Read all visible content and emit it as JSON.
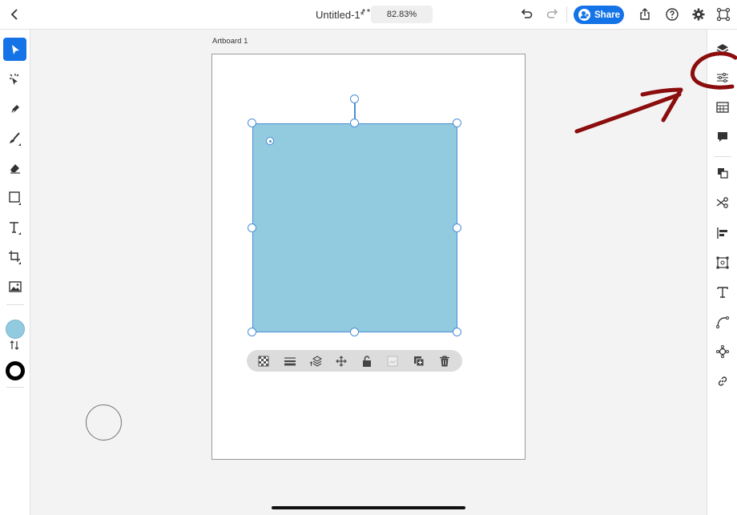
{
  "topbar": {
    "title": "Untitled-1*",
    "zoom": "82.83%",
    "share_label": "Share",
    "icons": [
      "back-chevron-icon",
      "more-dots-icon",
      "undo-icon",
      "redo-icon",
      "export-icon",
      "help-icon",
      "settings-icon",
      "plugins-icon"
    ]
  },
  "left_tools": [
    {
      "name": "select-tool",
      "active": true
    },
    {
      "name": "direct-select-tool",
      "active": false
    },
    {
      "name": "pen-tool",
      "active": false
    },
    {
      "name": "brush-tool",
      "active": false
    },
    {
      "name": "eraser-tool",
      "active": false
    },
    {
      "name": "rectangle-tool",
      "active": false
    },
    {
      "name": "text-tool",
      "active": false
    },
    {
      "name": "crop-tool",
      "active": false
    },
    {
      "name": "place-image-tool",
      "active": false
    }
  ],
  "colors": {
    "accent": "#1473e6",
    "fill": "#92cadf",
    "stroke": "#000000",
    "selection": "#4a8fd8",
    "annotation": "#8b0d0d"
  },
  "right_tools": [
    "layers-icon",
    "properties-icon",
    "swatches-icon",
    "comments-icon",
    "arrange-icon",
    "cut-icon",
    "align-icon",
    "transform-icon",
    "type-icon",
    "path-icon",
    "effects-icon",
    "link-icon"
  ],
  "artboard": {
    "label": "Artboard 1"
  },
  "context_bar": [
    "transparency-icon",
    "stroke-weight-icon",
    "arrange-layers-icon",
    "move-icon",
    "lock-icon",
    "image-icon",
    "duplicate-icon",
    "delete-icon"
  ]
}
